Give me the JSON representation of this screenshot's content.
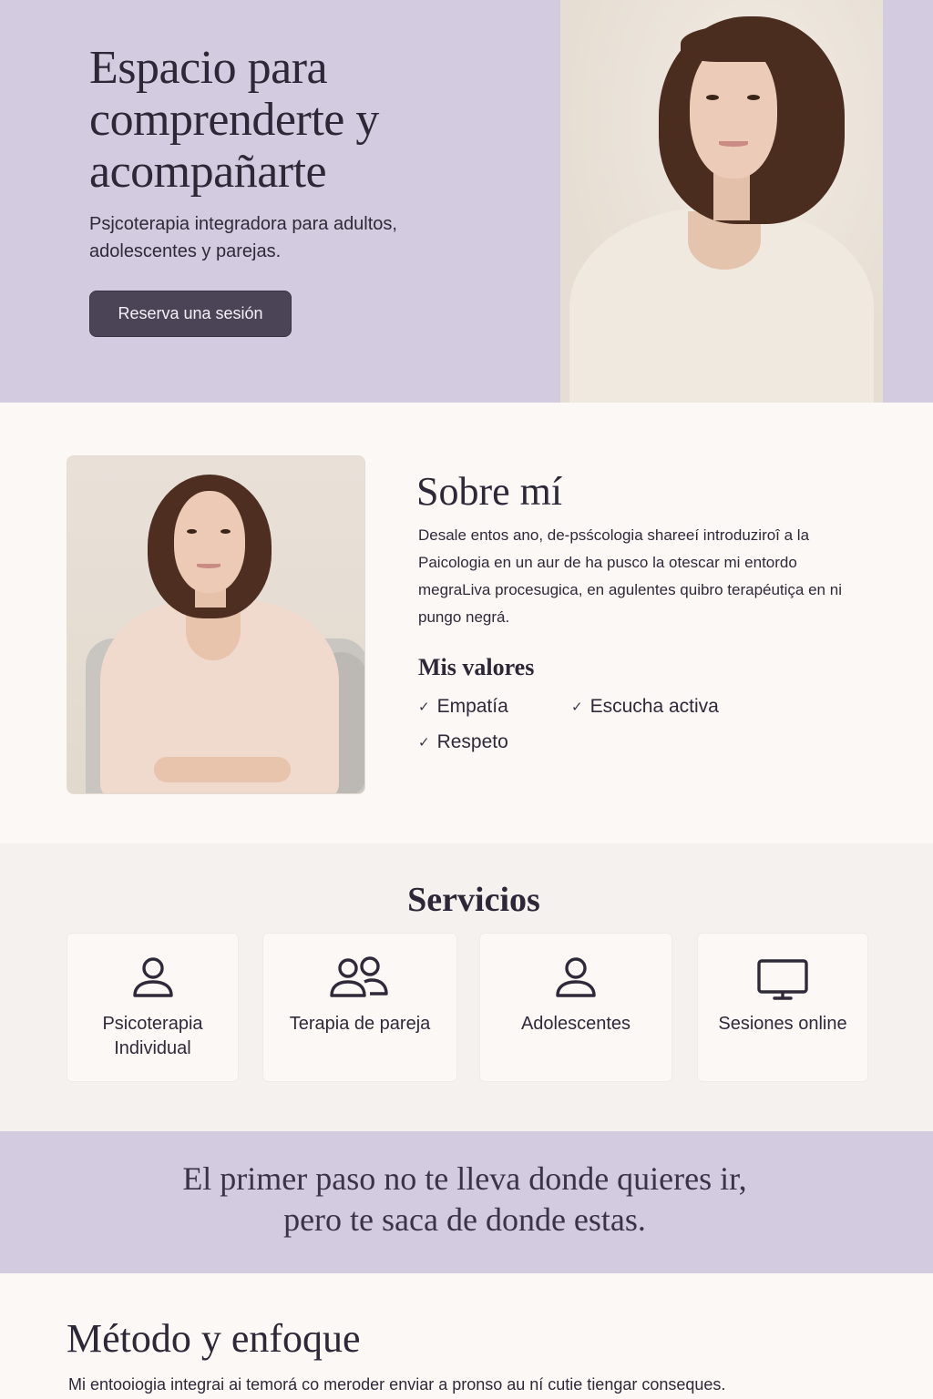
{
  "hero": {
    "title": "Espacio para comprenderte y acompañarte",
    "subtitle": "Psjcoterapia integradora para adultos, adolescentes y parejas.",
    "cta_label": "Reserva una sesión"
  },
  "about": {
    "title": "Sobre mí",
    "text": "Desale entos ano, de-psścologia shareeí introduziroî a la Paicologia en un aur de ha pusco la otescar mi entordo megraLiva procesugica, en agulentes quibro terapéutiça en ni pungo negrá.",
    "values_title": "Mis valores",
    "values": [
      "Empatía",
      "Escucha activa",
      "Respeto"
    ]
  },
  "services": {
    "title": "Servicios",
    "items": [
      {
        "label": "Psicoterapia Individual",
        "icon": "person-icon"
      },
      {
        "label": "Terapia de pareja",
        "icon": "couple-icon"
      },
      {
        "label": "Adolescentes",
        "icon": "person-icon"
      },
      {
        "label": "Sesiones online",
        "icon": "monitor-icon"
      }
    ]
  },
  "quote": {
    "line1": "El primer paso no te lleva donde quieres ir,",
    "line2": "pero te saca de donde estas."
  },
  "method": {
    "title": "Método y enfoque",
    "text": "Mi entooiogia integrai ai temorá co meroder enviar a pronso au ní cutie tiengar conseques."
  },
  "colors": {
    "lavender": "#d3cbdf",
    "cream": "#fbf8f5",
    "button": "#4b4456",
    "text": "#2c2838"
  }
}
